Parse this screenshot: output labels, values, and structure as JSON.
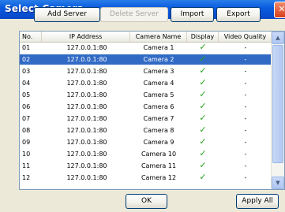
{
  "window": {
    "title": "Select Camera",
    "close_glyph": "✕"
  },
  "toolbar": {
    "add_server": "Add Server",
    "delete_server": "Delete Server",
    "import": "Import",
    "export": "Export"
  },
  "list": {
    "columns": [
      "No.",
      "IP Address",
      "Camera Name",
      "Display",
      "Video Quality"
    ],
    "rows": [
      {
        "no": "01",
        "ip": "127.0.0.1:80",
        "name": "Camera 1",
        "display": "✓",
        "quality": "-",
        "selected": false
      },
      {
        "no": "02",
        "ip": "127.0.0.1:80",
        "name": "Camera 2",
        "display": "✓",
        "quality": "-",
        "selected": true
      },
      {
        "no": "03",
        "ip": "127.0.0.1:80",
        "name": "Camera 3",
        "display": "✓",
        "quality": "-",
        "selected": false
      },
      {
        "no": "04",
        "ip": "127.0.0.1:80",
        "name": "Camera 4",
        "display": "✓",
        "quality": "-",
        "selected": false
      },
      {
        "no": "05",
        "ip": "127.0.0.1:80",
        "name": "Camera 5",
        "display": "✓",
        "quality": "-",
        "selected": false
      },
      {
        "no": "06",
        "ip": "127.0.0.1:80",
        "name": "Camera 6",
        "display": "✓",
        "quality": "-",
        "selected": false
      },
      {
        "no": "07",
        "ip": "127.0.0.1:80",
        "name": "Camera 7",
        "display": "✓",
        "quality": "-",
        "selected": false
      },
      {
        "no": "08",
        "ip": "127.0.0.1:80",
        "name": "Camera 8",
        "display": "✓",
        "quality": "-",
        "selected": false
      },
      {
        "no": "09",
        "ip": "127.0.0.1:80",
        "name": "Camera 9",
        "display": "✓",
        "quality": "-",
        "selected": false
      },
      {
        "no": "10",
        "ip": "127.0.0.1:80",
        "name": "Camera 10",
        "display": "✓",
        "quality": "-",
        "selected": false
      },
      {
        "no": "11",
        "ip": "127.0.0.1:80",
        "name": "Camera 11",
        "display": "✓",
        "quality": "-",
        "selected": false
      },
      {
        "no": "12",
        "ip": "127.0.0.1:80",
        "name": "Camera 12",
        "display": "✓",
        "quality": "-",
        "selected": false
      }
    ]
  },
  "scrollbar": {
    "up_glyph": "▲",
    "down_glyph": "▼"
  },
  "footer": {
    "ok": "OK",
    "apply_all": "Apply All"
  }
}
